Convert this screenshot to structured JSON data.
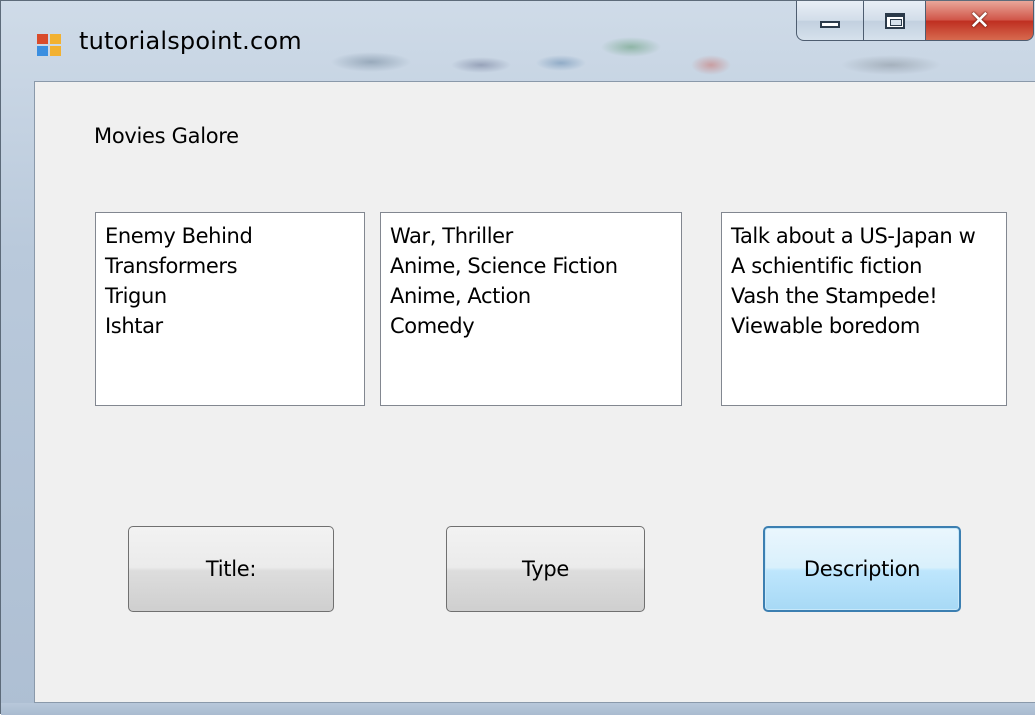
{
  "window": {
    "title": "tutorialspoint.com",
    "icons": {
      "app": "form-icon",
      "minimize": "minimize-icon",
      "maximize": "maximize-icon",
      "close": "close-icon"
    },
    "colors": {
      "close_button": "#c7402f",
      "frame": "#b9c9db",
      "client_background": "#f0f0f0",
      "focused_button_border": "#3c7fb1"
    }
  },
  "form": {
    "label": "Movies Galore",
    "titles": [
      "Enemy Behind",
      "Transformers",
      "Trigun",
      "Ishtar"
    ],
    "types": [
      "War, Thriller",
      "Anime, Science Fiction",
      "Anime, Action",
      "Comedy"
    ],
    "descriptions": [
      "Talk about a US-Japan w",
      "A schientific fiction",
      "Vash the Stampede!",
      "Viewable boredom"
    ],
    "buttons": {
      "title": "Title:",
      "type": "Type",
      "description": "Description"
    }
  }
}
